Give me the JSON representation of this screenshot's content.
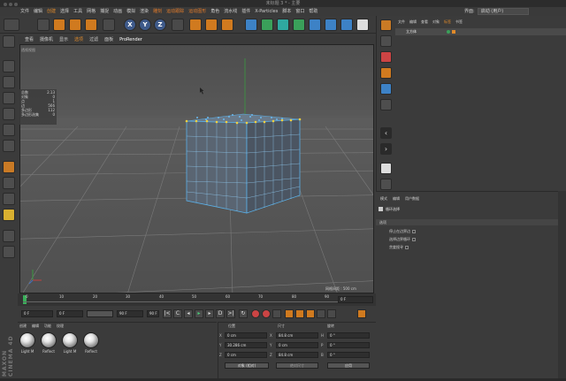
{
  "window": {
    "title": "未标题 3 * - 主要"
  },
  "menu": [
    "文件",
    "编辑",
    "创建",
    "选择",
    "工具",
    "网格",
    "捕捉",
    "动画",
    "模拟",
    "渲染",
    "雕刻",
    "运动跟踪",
    "运动图形",
    "角色",
    "流水线",
    "插件",
    "X-Particles",
    "脚本",
    "窗口",
    "帮助"
  ],
  "layout": {
    "label": "界面:",
    "value": "启动 (用户)"
  },
  "viewport": {
    "menu": [
      "查看",
      "摄像机",
      "显示",
      "选项",
      "过滤",
      "面板",
      "ProRender"
    ],
    "selected_menu": "选项",
    "camera_label": "透视视图",
    "grid_info": "网格间距 : 500 cm"
  },
  "stats": [
    {
      "k": "总数",
      "v": "2.13"
    },
    {
      "k": "对象",
      "v": "0"
    },
    {
      "k": "点",
      "v": "1"
    },
    {
      "k": "边",
      "v": "566"
    },
    {
      "k": "多边形",
      "v": "112"
    },
    {
      "k": "多边形选集",
      "v": "0"
    }
  ],
  "timeline": {
    "ticks": [
      "0",
      "10",
      "20",
      "30",
      "40",
      "50",
      "60",
      "70",
      "80",
      "90"
    ],
    "current": "0 F",
    "start": "0 F",
    "end": "90 F",
    "end2": "90 F",
    "frame_right": "0 F"
  },
  "materials": {
    "menu": [
      "创建",
      "编辑",
      "功能",
      "纹理"
    ],
    "items": [
      {
        "name": "Light M"
      },
      {
        "name": "Reflect"
      },
      {
        "name": "Light M"
      },
      {
        "name": "Reflect"
      }
    ]
  },
  "coords": {
    "headers": [
      "位置",
      "尺寸",
      "旋转"
    ],
    "rows": [
      {
        "axis": "X",
        "pos": "0 cm",
        "size": "84.8 cm",
        "rot_axis": "H",
        "rot": "0 °"
      },
      {
        "axis": "Y",
        "pos": "30.286 cm",
        "size": "0 cm",
        "rot_axis": "P",
        "rot": "0 °"
      },
      {
        "axis": "Z",
        "pos": "0 cm",
        "size": "84.8 cm",
        "rot_axis": "B",
        "rot": "0 °"
      }
    ],
    "mode": "对象 (相对)",
    "size_mode": "绝对尺寸",
    "apply": "应用"
  },
  "object_manager": {
    "menu": [
      "文件",
      "编辑",
      "查看",
      "对象",
      "标签",
      "书签"
    ],
    "object": "立方体"
  },
  "attributes": {
    "menu": [
      "模式",
      "编辑",
      "用户数据"
    ],
    "title": "循环选择",
    "section": "选项",
    "options": [
      "停止在边界边",
      "选择边界循环",
      "贪婪搜寻"
    ]
  },
  "brand": "MAXON CINEMA 4D"
}
